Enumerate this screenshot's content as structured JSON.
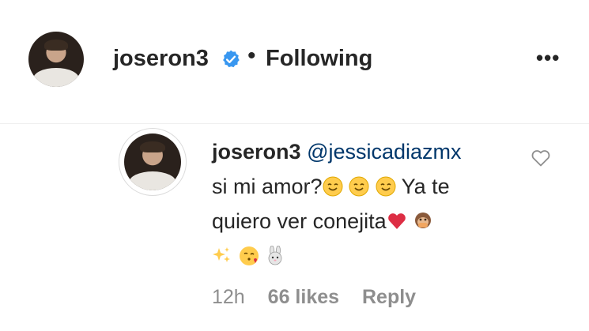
{
  "header": {
    "username": "joseron3",
    "separator": "•",
    "follow_status": "Following",
    "more_icon": "•••",
    "verified_icon": "verified-badge-icon"
  },
  "comment": {
    "username": "joseron3",
    "mention": "@jessicadiazmx",
    "text_part1": "si mi amor?",
    "text_part2": " Ya te quiero ver conejita",
    "emojis": [
      "smiling-face-emoji",
      "smiling-face-emoji",
      "smiling-face-emoji",
      "red-heart-emoji",
      "speak-no-evil-monkey-emoji",
      "sparkles-emoji",
      "face-blowing-kiss-emoji",
      "rabbit-face-emoji"
    ],
    "time": "12h",
    "likes": "66 likes",
    "reply": "Reply"
  },
  "colors": {
    "text": "#262626",
    "mention": "#00376b",
    "muted": "#8e8e8e",
    "verified": "#3897f0"
  }
}
